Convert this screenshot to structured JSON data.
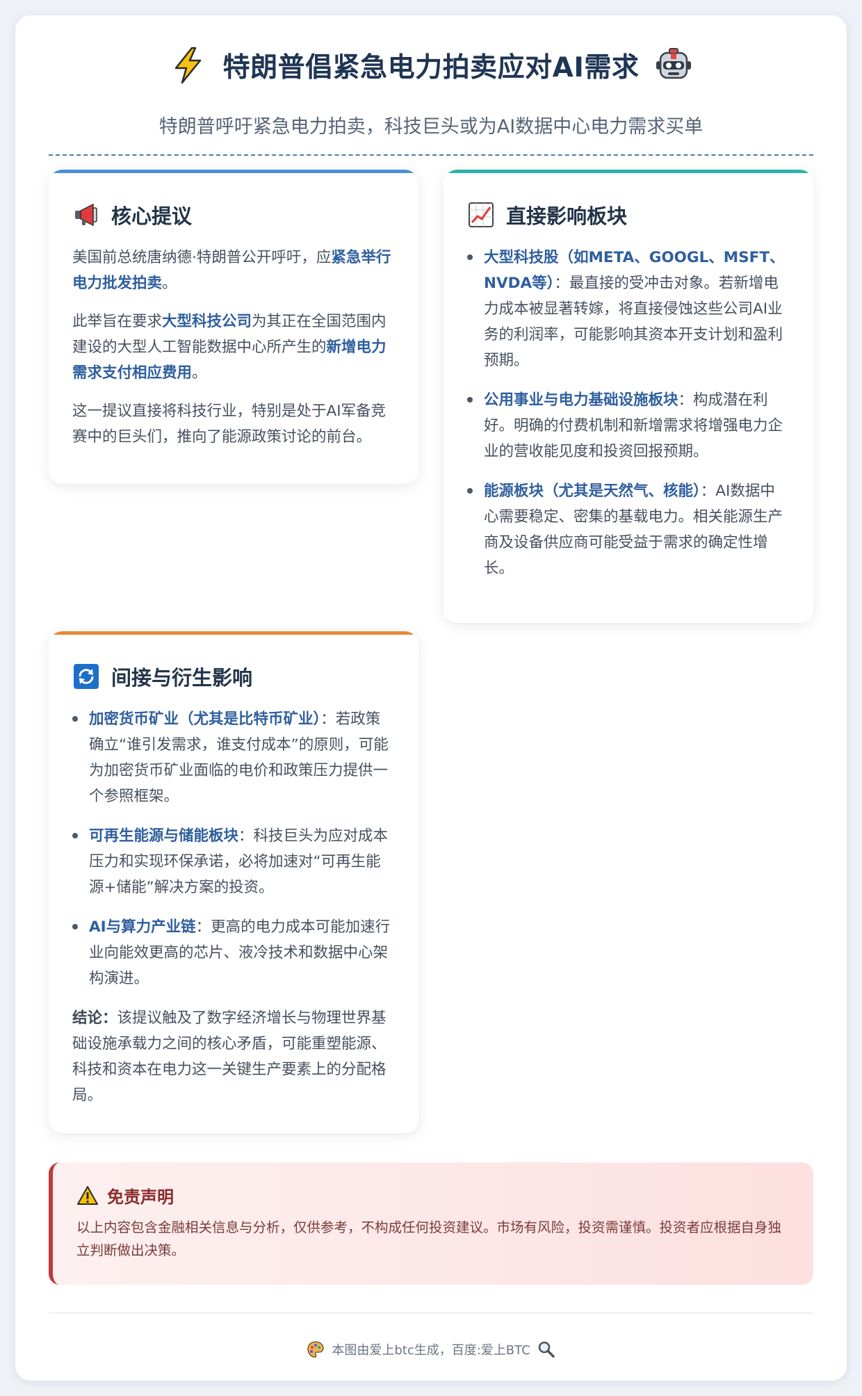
{
  "header": {
    "title": "特朗普倡紧急电力拍卖应对AI需求",
    "subtitle": "特朗普呼吁紧急电力拍卖，科技巨头或为AI数据中心电力需求买单",
    "title_icon_left": "lightning-icon",
    "title_icon_right": "robot-icon"
  },
  "cards": {
    "core": {
      "icon": "megaphone-icon",
      "accent": "#4a90d9",
      "title": "核心提议",
      "p1": {
        "a": "美国前总统唐纳德·特朗普公开呼吁，应",
        "b": "紧急举行电力批发拍卖",
        "c": "。"
      },
      "p2": {
        "a": "此举旨在要求",
        "b": "大型科技公司",
        "c": "为其正在全国范围内建设的大型人工智能数据中心所产生的",
        "d": "新增电力需求支付相应费用",
        "e": "。"
      },
      "p3": "这一提议直接将科技行业，特别是处于AI军备竞赛中的巨头们，推向了能源政策讨论的前台。"
    },
    "direct": {
      "icon": "chart-increasing-icon",
      "accent": "#2ab3a6",
      "title": "直接影响板块",
      "items": [
        {
          "label": "大型科技股（如META、GOOGL、MSFT、NVDA等）",
          "text": "：最直接的受冲击对象。若新增电力成本被显著转嫁，将直接侵蚀这些公司AI业务的利润率，可能影响其资本开支计划和盈利预期。"
        },
        {
          "label": "公用事业与电力基础设施板块",
          "text": "：构成潜在利好。明确的付费机制和新增需求将增强电力企业的营收能见度和投资回报预期。"
        },
        {
          "label": "能源板块（尤其是天然气、核能）",
          "text": "：AI数据中心需要稳定、密集的基载电力。相关能源生产商及设备供应商可能受益于需求的确定性增长。"
        }
      ]
    },
    "indirect": {
      "icon": "cycle-arrows-icon",
      "accent": "#e8893a",
      "title": "间接与衍生影响",
      "items": [
        {
          "label": "加密货币矿业（尤其是比特币矿业）",
          "text": "：若政策确立“谁引发需求，谁支付成本”的原则，可能为加密货币矿业面临的电价和政策压力提供一个参照框架。"
        },
        {
          "label": "可再生能源与储能板块",
          "text": "：科技巨头为应对成本压力和实现环保承诺，必将加速对“可再生能源+储能”解决方案的投资。"
        },
        {
          "label": "AI与算力产业链",
          "text": "：更高的电力成本可能加速行业向能效更高的芯片、液冷技术和数据中心架构演进。"
        }
      ],
      "conclusion_label": "结论：",
      "conclusion_text": "该提议触及了数字经济增长与物理世界基础设施承载力之间的核心矛盾，可能重塑能源、科技和资本在电力这一关键生产要素上的分配格局。"
    }
  },
  "disclaimer": {
    "icon": "warning-icon",
    "title": "免责声明",
    "text": "以上内容包含金融相关信息与分析，仅供参考，不构成任何投资建议。市场有风险，投资需谨慎。投资者应根据自身独立判断做出决策。"
  },
  "footer": {
    "icon_left": "palette-icon",
    "text": "本图由爱上btc生成，百度:爱上BTC",
    "icon_right": "magnifier-icon"
  }
}
